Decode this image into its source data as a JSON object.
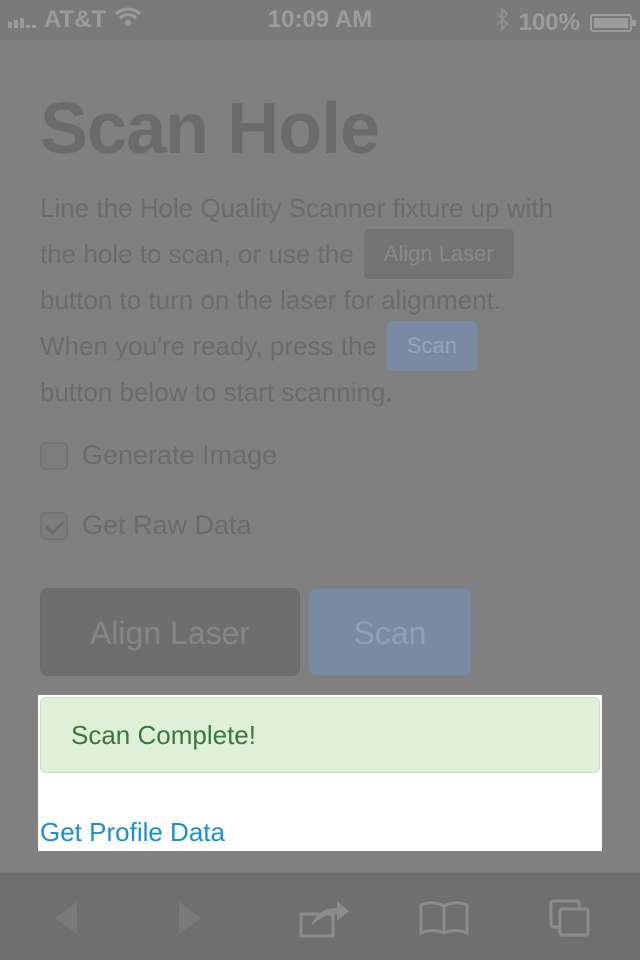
{
  "status_bar": {
    "carrier": "AT&T",
    "time": "10:09 AM",
    "battery_percent": "100%"
  },
  "page": {
    "title": "Scan Hole",
    "instructions": {
      "part1": "Line the Hole Quality Scanner fixture up with",
      "part2": "the hole to scan, or use the",
      "inline_align_label": "Align Laser",
      "part3": "button to turn on the laser for alignment.",
      "part4": "When you're ready, press the",
      "inline_scan_label": "Scan",
      "part5": "button below to start scanning."
    },
    "options": [
      {
        "label": "Generate Image",
        "checked": false
      },
      {
        "label": "Get Raw Data",
        "checked": true
      }
    ],
    "buttons": {
      "align_label": "Align Laser",
      "scan_label": "Scan"
    }
  },
  "result": {
    "alert_text": "Scan Complete!",
    "link_text": "Get Profile Data"
  },
  "toolbar": {
    "items": [
      "back-icon",
      "forward-icon",
      "share-icon",
      "bookmarks-icon",
      "tabs-icon"
    ]
  },
  "colors": {
    "success_bg": "#dff0d8",
    "success_text": "#3c763d",
    "link": "#1a8fd6",
    "dim_overlay": "#808080"
  }
}
